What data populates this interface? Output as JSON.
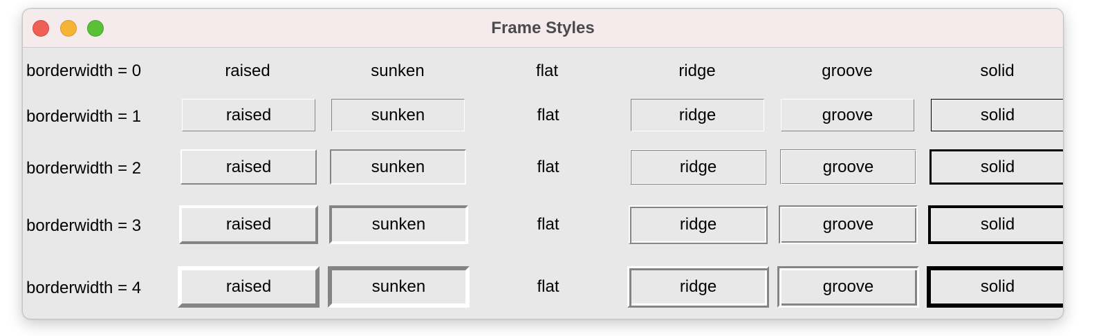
{
  "window": {
    "title": "Frame Styles"
  },
  "rows": [
    {
      "label": "borderwidth = 0",
      "cells": [
        "raised",
        "sunken",
        "flat",
        "ridge",
        "groove",
        "solid"
      ]
    },
    {
      "label": "borderwidth = 1",
      "cells": [
        "raised",
        "sunken",
        "flat",
        "ridge",
        "groove",
        "solid"
      ]
    },
    {
      "label": "borderwidth = 2",
      "cells": [
        "raised",
        "sunken",
        "flat",
        "ridge",
        "groove",
        "solid"
      ]
    },
    {
      "label": "borderwidth = 3",
      "cells": [
        "raised",
        "sunken",
        "flat",
        "ridge",
        "groove",
        "solid"
      ]
    },
    {
      "label": "borderwidth = 4",
      "cells": [
        "raised",
        "sunken",
        "flat",
        "ridge",
        "groove",
        "solid"
      ]
    }
  ],
  "colors": {
    "light": "#ffffff",
    "dark": "#848484",
    "solid": "#000000",
    "background": "#e8e8e8"
  }
}
